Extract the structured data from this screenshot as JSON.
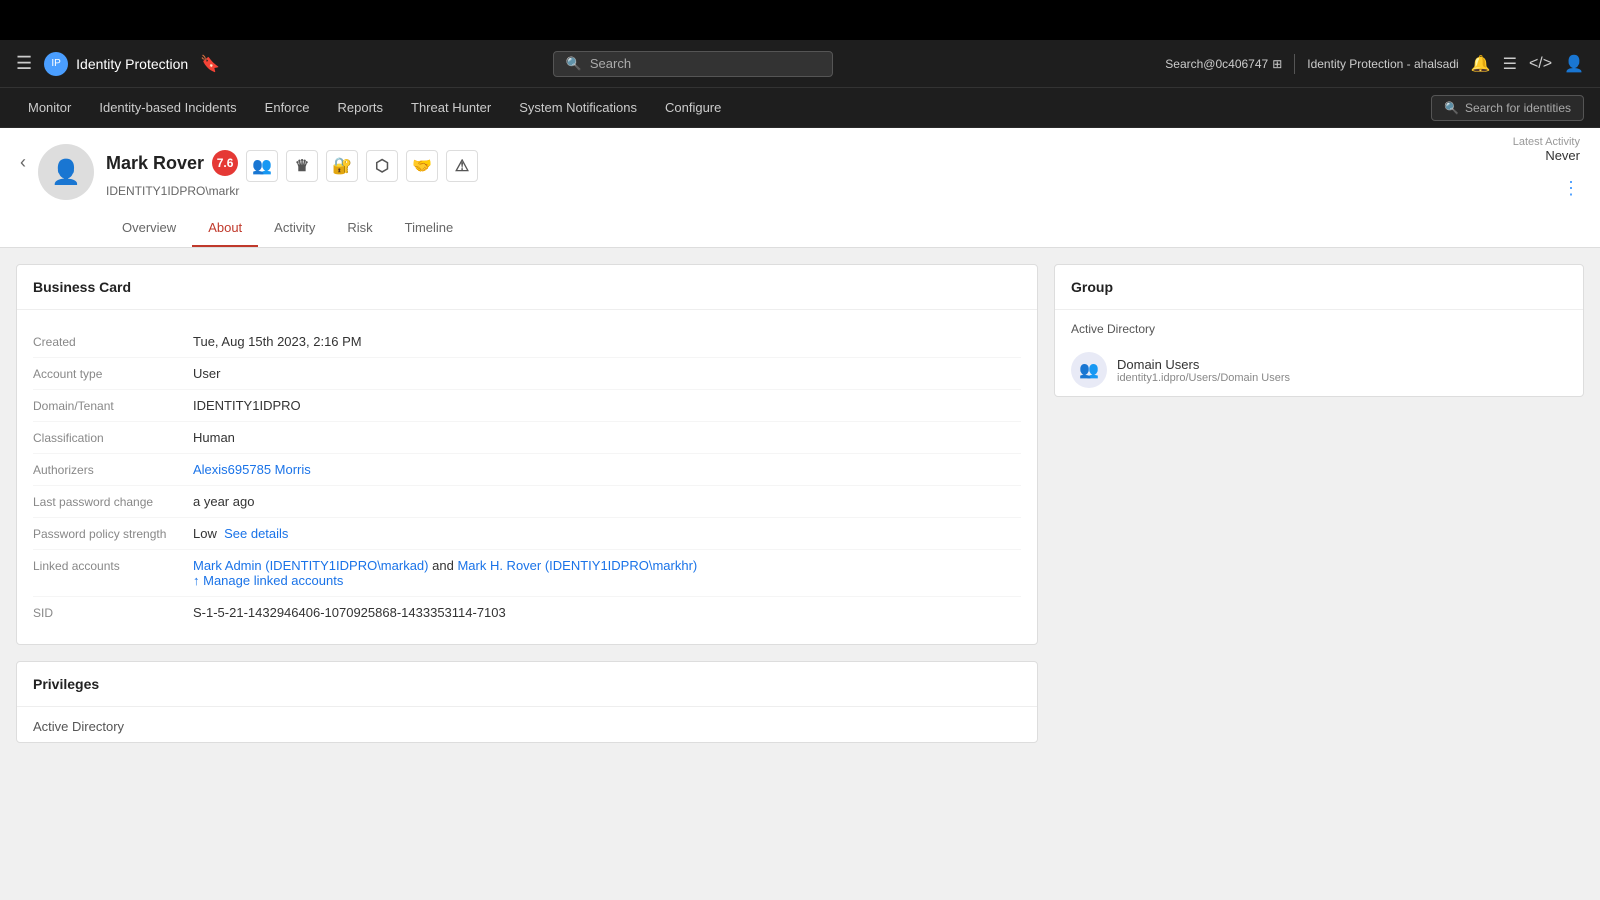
{
  "topBar": {},
  "navBar": {
    "hamburger": "☰",
    "logoText": "Identity Protection",
    "bookmark": "🔖",
    "search": {
      "icon": "🔍",
      "placeholder": "Search"
    },
    "searchContext": "Search@0c406747",
    "productName": "Identity Protection - ahalsadi",
    "icons": {
      "bell": "🔔",
      "list": "☰",
      "code": "</>",
      "user": "👤"
    }
  },
  "menuBar": {
    "items": [
      "Monitor",
      "Identity-based Incidents",
      "Enforce",
      "Reports",
      "Threat Hunter",
      "System Notifications",
      "Configure"
    ],
    "searchIdentities": {
      "icon": "🔍",
      "label": "Search for identities"
    }
  },
  "profile": {
    "name": "Mark Rover",
    "username": "IDENTITY1IDPRO\\markr",
    "riskScore": "7.6",
    "tabs": [
      "Overview",
      "About",
      "Activity",
      "Risk",
      "Timeline"
    ],
    "activeTab": "About",
    "latestActivity": {
      "label": "Latest Activity",
      "value": "Never"
    }
  },
  "businessCard": {
    "title": "Business Card",
    "fields": [
      {
        "label": "Created",
        "value": "Tue, Aug 15th 2023, 2:16 PM",
        "isLink": false
      },
      {
        "label": "Account type",
        "value": "User",
        "isLink": false
      },
      {
        "label": "Domain/Tenant",
        "value": "IDENTITY1IDPRO",
        "isLink": false
      },
      {
        "label": "Classification",
        "value": "Human",
        "isLink": false
      },
      {
        "label": "Authorizers",
        "value": "Alexis695785 Morris",
        "isLink": true
      },
      {
        "label": "Last password change",
        "value": "a year ago",
        "isLink": false
      },
      {
        "label": "Password policy strength",
        "value": "Low",
        "isLink": false,
        "extra": "See details"
      },
      {
        "label": "Linked accounts",
        "value": "Mark Admin (IDENTITY1IDPRO\\markad) and Mark H. Rover (IDENTITY1Y1IDPRO\\markhr)",
        "isLink": true,
        "extra": "↑ Manage linked accounts"
      },
      {
        "label": "SID",
        "value": "S-1-5-21-1432946406-1070925868-1433353114-7103",
        "isLink": false
      }
    ]
  },
  "group": {
    "title": "Group",
    "sectionLabel": "Active Directory",
    "items": [
      {
        "name": "Domain Users",
        "path": "identity1.idpro/Users/Domain Users",
        "icon": "👥"
      }
    ]
  },
  "privileges": {
    "title": "Privileges",
    "sectionLabel": "Active Directory"
  },
  "icons": {
    "shield": "⬡",
    "crown": "♛",
    "lock": "🔒",
    "network": "⬡",
    "handshake": "🤝",
    "warning": "⚠"
  }
}
